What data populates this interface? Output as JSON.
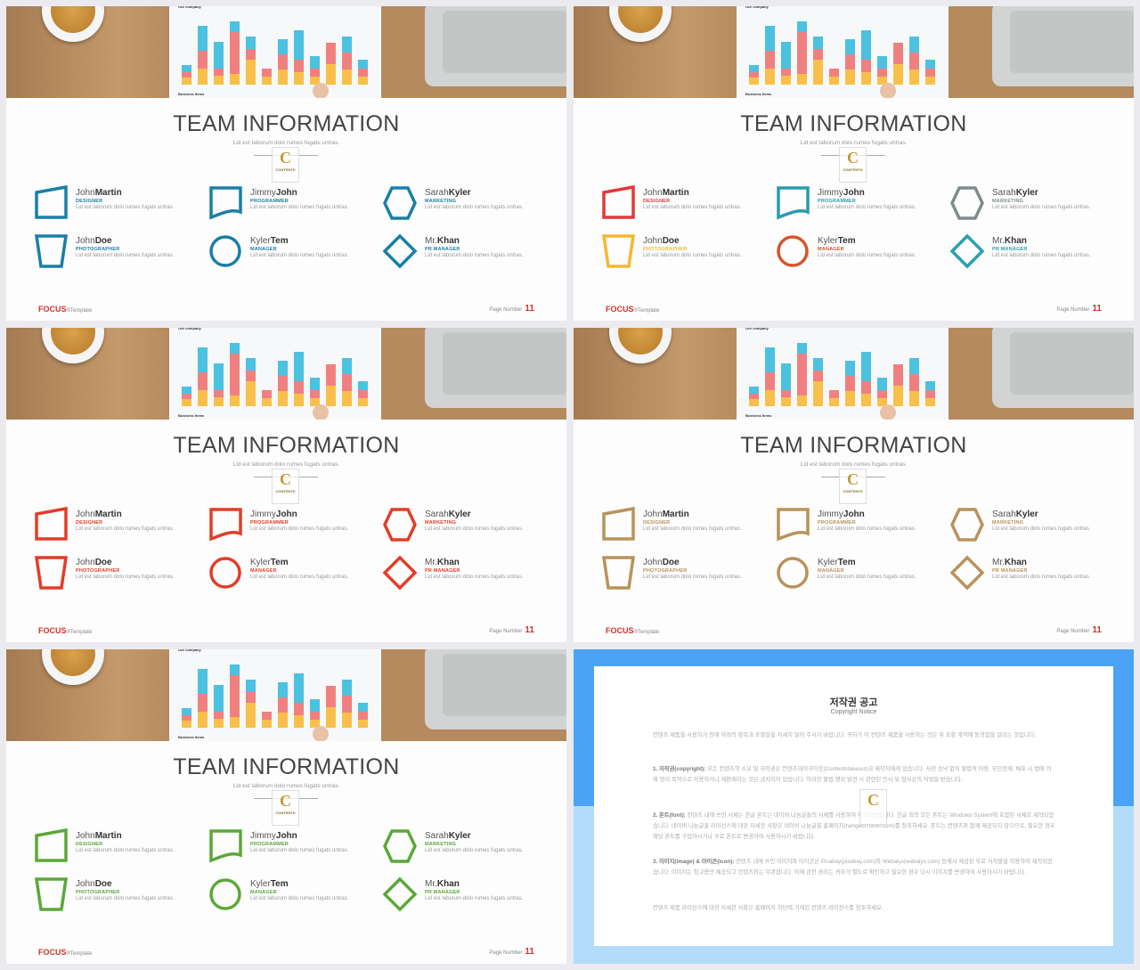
{
  "team_slide": {
    "title": "TEAM INFORMATION",
    "subtitle": "Lid est laborum dolo rumes fugats untras.",
    "logo_text": "CONTENTS",
    "chart_photo": {
      "title": "Our company",
      "footer": "Business Items"
    },
    "brand": "FOCUS",
    "brand_suffix": "®Template",
    "page_label": "Page Number",
    "page_number": "11",
    "members": [
      {
        "first": "John",
        "last": "Martin",
        "role": "DESIGNER",
        "desc": "Lid est laborum dolo rumes fugats untras.",
        "shape": "trapezoid-slant"
      },
      {
        "first": "Jimmy",
        "last": "John",
        "role": "PROGRAMMER",
        "desc": "Lid est laborum dolo rumes fugats untras.",
        "shape": "wave-document"
      },
      {
        "first": "Sarah",
        "last": "Kyler",
        "role": "MARKETING",
        "desc": "Lid est laborum dolo rumes fugats untras.",
        "shape": "hexagon"
      },
      {
        "first": "John",
        "last": "Doe",
        "role": "PHOTOGRAPHER",
        "desc": "Lid est laborum dolo rumes fugats untras.",
        "shape": "trapezoid"
      },
      {
        "first": "Kyler",
        "last": "Tem",
        "role": "MANAGER",
        "desc": "Lid est laborum dolo rumes fugats untras.",
        "shape": "circle"
      },
      {
        "first": "Mr.",
        "last": "Khan",
        "role": "PR MANAGER",
        "desc": "Lid est laborum dolo rumes fugats untras.",
        "shape": "diamond"
      }
    ]
  },
  "variants": [
    {
      "member_colors": [
        "#1a7fa6",
        "#1a7fa6",
        "#1a7fa6",
        "#1a7fa6",
        "#1a7fa6",
        "#1a7fa6"
      ]
    },
    {
      "member_colors": [
        "#e0393a",
        "#2a9bb0",
        "#7f8c8d",
        "#f5b731",
        "#d9542b",
        "#2aa0b0"
      ]
    },
    {
      "member_colors": [
        "#e23d28",
        "#e23d28",
        "#e23d28",
        "#e23d28",
        "#e23d28",
        "#e23d28"
      ]
    },
    {
      "member_colors": [
        "#b8935a",
        "#b8935a",
        "#b8935a",
        "#b8935a",
        "#b8935a",
        "#b8935a"
      ]
    },
    {
      "member_colors": [
        "#5ba83a",
        "#5ba83a",
        "#5ba83a",
        "#5ba83a",
        "#5ba83a",
        "#5ba83a"
      ]
    }
  ],
  "copyright": {
    "title": "저작권 공고",
    "subtitle": "Copyright Notice",
    "intro": "컨텐츠 제품을 사용하기 전에 아래의 항목과 조항들을 자세히 읽어 주시기 바랍니다. 귀하가 이 컨텐츠 제품을 사용하는 것은 위 조항 계약에 동의함을 알리는 것입니다.",
    "sections": [
      {
        "heading": "1. 저작권(copyright):",
        "text": "모든 컨텐츠의 소유 및 저작권은 컨텐츠테이크아웃(Contentstakeout)과 제작자에게 있습니다. 사전 승낙 없이 불법적 이용, 무단전재, 배포 시 법에 의해 영리 목적으로 이용하거나 재판매하는 것은 금지되어 있습니다. 이러한 불법 행위 발견 시 관련된 민사 및 형사상의 처벌을 받습니다."
      },
      {
        "heading": "2. 폰트(font):",
        "text": "컨텐츠 내에 쓰인 서체는 한글 폰트는 네이버 나눔글꼴의 서체를 사용하여 제작되었습니다. 한글 외의 모든 폰트는 Windows System에 포함된 서체로 제작되었습니다. 네이버 나눔글꼴 라이선스에 대한 자세한 사항은 네이버 나눔글꼴 홈페이지(hangeul.naver.com)를 참조하세요. 폰트는 컨텐츠와 함께 제공되지 않으므로, 필요한 경우 해당 폰트를 구입하시거나 무료 폰트로 변경하여 사용하시기 바랍니다."
      },
      {
        "heading": "3. 이미지(image) & 아이콘(icon):",
        "text": "컨텐츠 내에 쓰인 이미지와 아이콘은 Pixabay(pixabay.com)와 Webalys(webalys.com) 등에서 제공된 무료 저작물을 이용하여 제작되었습니다. 이미지는 참고용만 제공되고 컨텐츠와는 무관합니다. 이에 관한 권리는 귀하가 별도로 확인하고 필요한 경우 다시 이미지를 변경하여 사용하시기 바랍니다."
      }
    ],
    "outro": "컨텐츠 제품 라이선스에 대한 자세한 사항은 홈페이지 하단에 기재된 컨텐츠 라이선스를 참조하세요."
  }
}
